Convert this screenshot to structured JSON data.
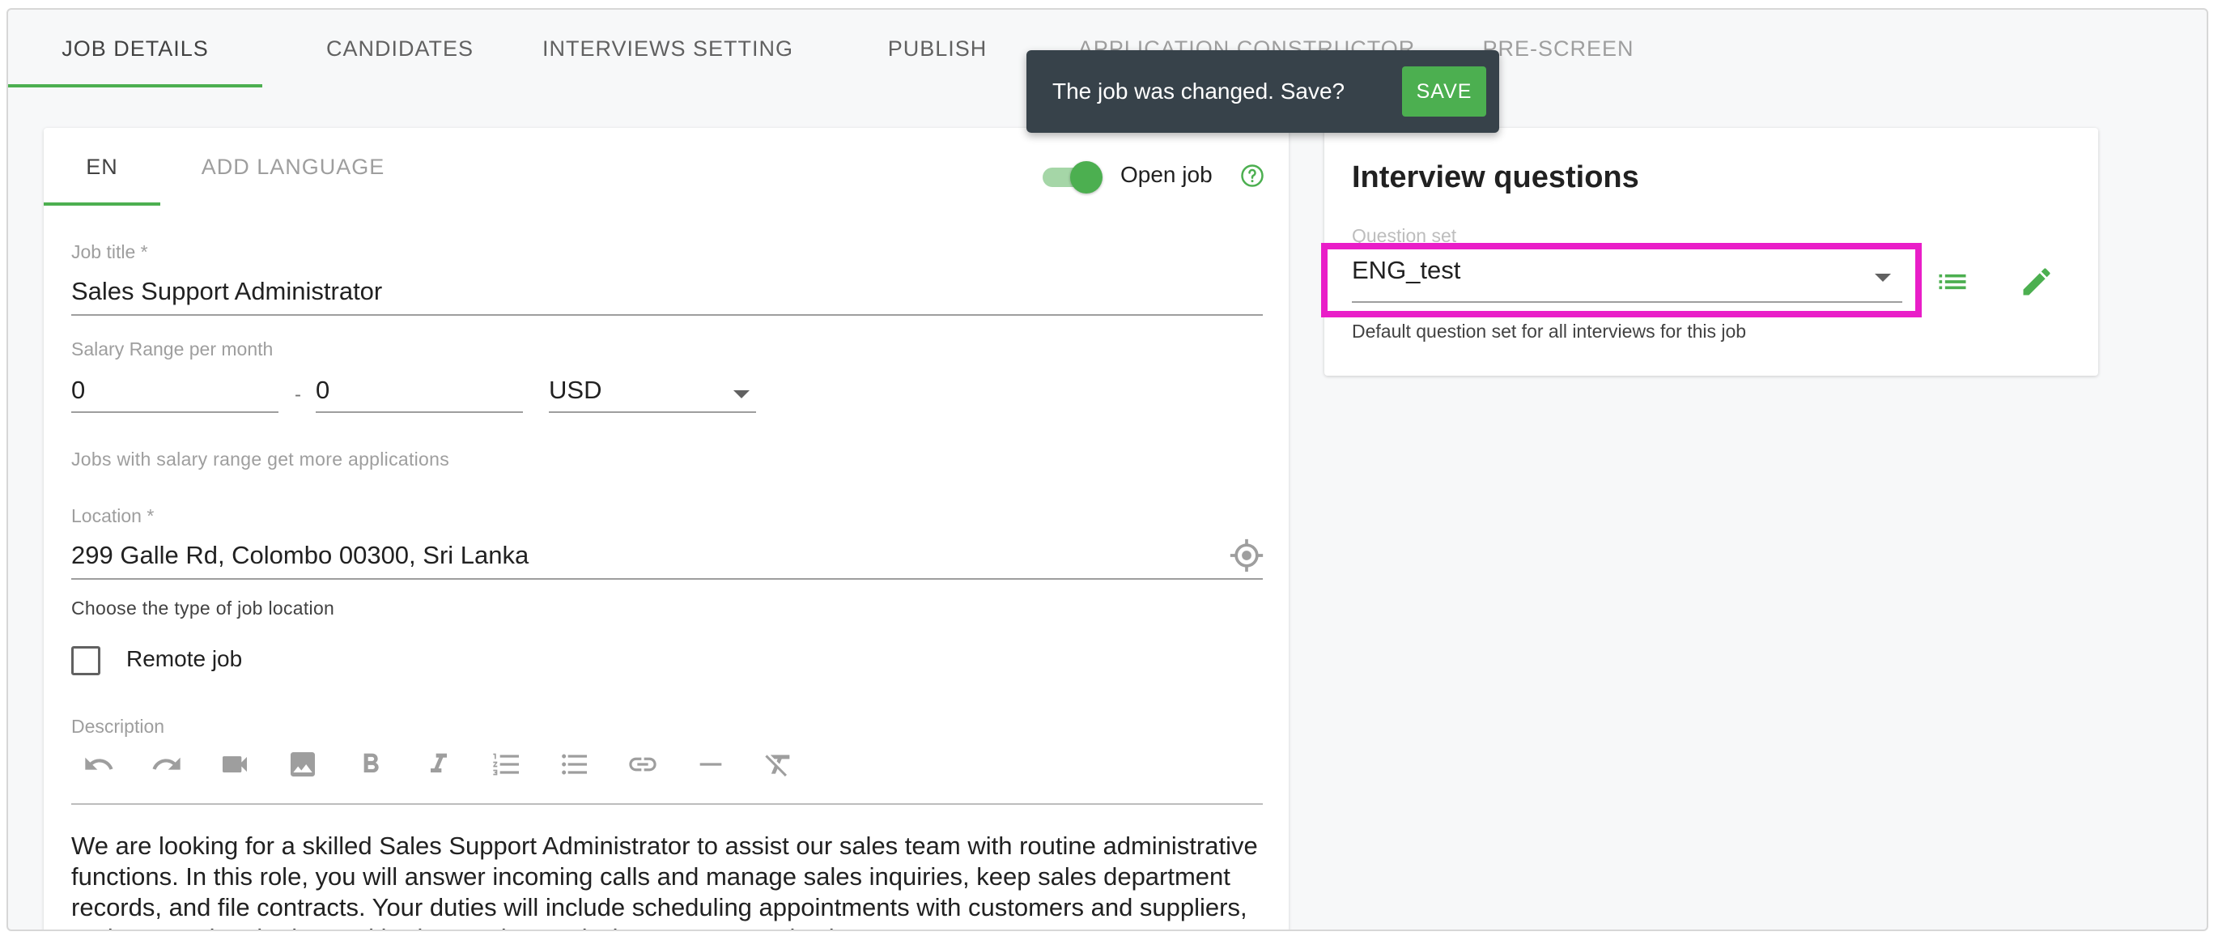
{
  "tabs": [
    {
      "label": "JOB DETAILS"
    },
    {
      "label": "CANDIDATES"
    },
    {
      "label": "INTERVIEWS SETTING"
    },
    {
      "label": "PUBLISH"
    },
    {
      "label": "APPLICATION CONSTRUCTOR"
    },
    {
      "label": "PRE-SCREEN"
    }
  ],
  "snackbar": {
    "message": "The job was changed. Save?",
    "save_label": "SAVE"
  },
  "language_tabs": [
    {
      "label": "EN"
    },
    {
      "label": "ADD LANGUAGE"
    }
  ],
  "open_job": {
    "label": "Open job",
    "on": true
  },
  "job_title": {
    "label": "Job title *",
    "value": "Sales Support Administrator"
  },
  "salary": {
    "label": "Salary Range per month",
    "min": "0",
    "separator": "-",
    "max": "0",
    "currency": "USD",
    "hint": "Jobs with salary range get more applications"
  },
  "location": {
    "label": "Location *",
    "value": "299 Galle Rd, Colombo 00300, Sri Lanka",
    "type_label": "Choose the type of job location"
  },
  "remote": {
    "label": "Remote job",
    "checked": false
  },
  "description": {
    "label": "Description",
    "toolbar": [
      "undo-icon",
      "redo-icon",
      "video-icon",
      "image-icon",
      "bold-icon",
      "italic-icon",
      "numbered-list-icon",
      "bullet-list-icon",
      "link-icon",
      "horizontal-rule-icon",
      "clear-format-icon"
    ],
    "text": "We are looking for a skilled Sales Support Administrator to assist our sales team with routine administrative functions. In this role, you will answer incoming calls and manage sales inquiries, keep sales department records, and file contracts. Your duties will include scheduling appointments with customers and suppliers, and overseeing the internal budget and commissions. You may also be"
  },
  "interview_questions": {
    "title": "Interview questions",
    "question_set_label": "Question set",
    "question_set_value": "ENG_test",
    "hint": "Default question set for all interviews for this job"
  },
  "colors": {
    "accent": "#4caf50",
    "highlight": "#e91ec8",
    "snackbar": "#37424a"
  }
}
